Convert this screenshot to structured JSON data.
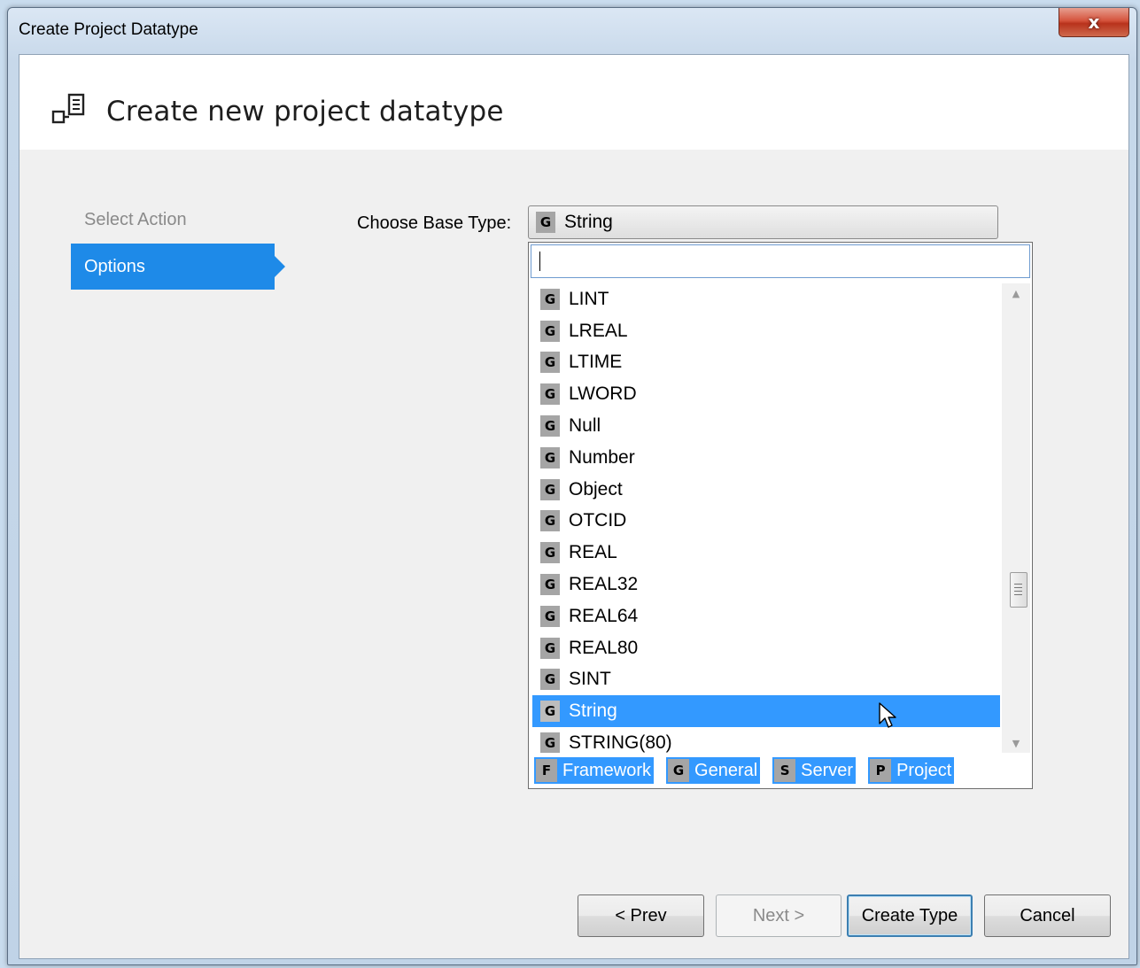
{
  "window": {
    "title": "Create Project Datatype",
    "close_label": "x"
  },
  "header": {
    "title": "Create new project datatype",
    "icon": "datatype-icon"
  },
  "nav": {
    "items": [
      {
        "label": "Select Action",
        "active": false
      },
      {
        "label": "Options",
        "active": true
      }
    ]
  },
  "form": {
    "base_type_label": "Choose Base Type:",
    "selected": {
      "badge": "G",
      "label": "String"
    },
    "search_value": ""
  },
  "list": {
    "items": [
      {
        "badge": "G",
        "label": "LINT"
      },
      {
        "badge": "G",
        "label": "LREAL"
      },
      {
        "badge": "G",
        "label": "LTIME"
      },
      {
        "badge": "G",
        "label": "LWORD"
      },
      {
        "badge": "G",
        "label": "Null"
      },
      {
        "badge": "G",
        "label": "Number"
      },
      {
        "badge": "G",
        "label": "Object"
      },
      {
        "badge": "G",
        "label": "OTCID"
      },
      {
        "badge": "G",
        "label": "REAL"
      },
      {
        "badge": "G",
        "label": "REAL32"
      },
      {
        "badge": "G",
        "label": "REAL64"
      },
      {
        "badge": "G",
        "label": "REAL80"
      },
      {
        "badge": "G",
        "label": "SINT"
      },
      {
        "badge": "G",
        "label": "String"
      },
      {
        "badge": "G",
        "label": "STRING(80)"
      }
    ],
    "selected_index": 13
  },
  "filters": [
    {
      "badge": "F",
      "label": "Framework"
    },
    {
      "badge": "G",
      "label": "General"
    },
    {
      "badge": "S",
      "label": "Server"
    },
    {
      "badge": "P",
      "label": "Project"
    }
  ],
  "buttons": {
    "prev": "< Prev",
    "next": "Next >",
    "create": "Create Type",
    "cancel": "Cancel"
  },
  "colors": {
    "accent": "#1e8ae8",
    "selection": "#3399ff",
    "badge": "#a5a5a5"
  }
}
